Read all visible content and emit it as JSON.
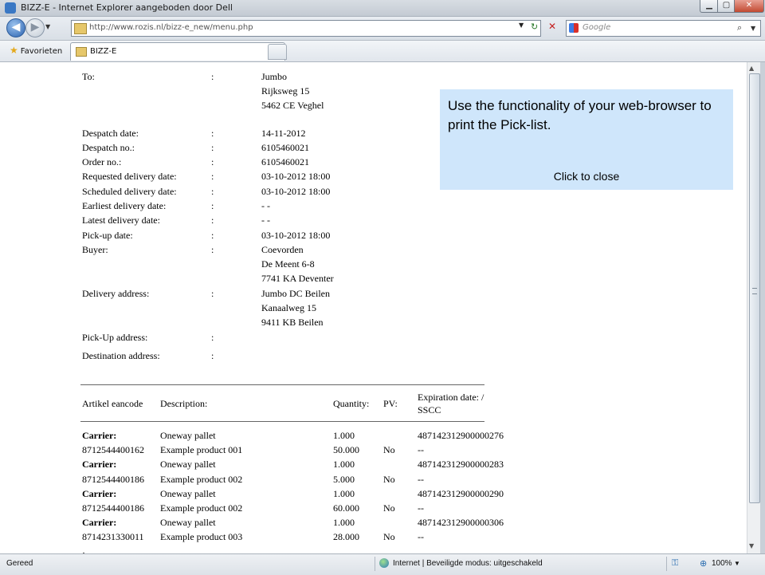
{
  "window": {
    "title": "BIZZ-E - Internet Explorer aangeboden door Dell",
    "min_glyph": "▁",
    "max_glyph": "▢",
    "close_glyph": "✕"
  },
  "toolbar": {
    "url": "http://www.rozis.nl/bizz-e_new/menu.php",
    "back_glyph": "◀",
    "forward_glyph": "▶",
    "refresh_glyph": "↻",
    "stop_glyph": "✕",
    "search_placeholder": "Google",
    "search_glyph": "⌕",
    "dropdown_glyph": "▼"
  },
  "favorites": {
    "favorites_label": "Favorieten",
    "tab_label": "BIZZ-E"
  },
  "header_fields": [
    {
      "label": "To:",
      "sep": ":",
      "lines": [
        "Jumbo",
        "Rijksweg 15",
        "5462 CE Veghel"
      ]
    },
    {
      "label": "Despatch date:",
      "sep": ":",
      "lines": [
        "14-11-2012"
      ]
    },
    {
      "label": "Despatch no.:",
      "sep": ":",
      "lines": [
        "6105460021"
      ]
    },
    {
      "label": "Order no.:",
      "sep": ":",
      "lines": [
        "6105460021"
      ]
    },
    {
      "label": "Requested delivery date:",
      "sep": ":",
      "lines": [
        "03-10-2012 18:00"
      ]
    },
    {
      "label": "Scheduled delivery date:",
      "sep": ":",
      "lines": [
        "03-10-2012 18:00"
      ]
    },
    {
      "label": "Earliest delivery date:",
      "sep": ":",
      "lines": [
        "- -"
      ]
    },
    {
      "label": "Latest delivery date:",
      "sep": ":",
      "lines": [
        "- -"
      ]
    },
    {
      "label": "Pick-up date:",
      "sep": ":",
      "lines": [
        "03-10-2012 18:00"
      ]
    },
    {
      "label": "Buyer:",
      "sep": ":",
      "lines": [
        "Coevorden",
        "De Meent 6-8",
        "7741 KA Deventer"
      ]
    },
    {
      "label": "Delivery address:",
      "sep": ":",
      "lines": [
        "Jumbo DC Beilen",
        "Kanaalweg 15",
        "9411 KB Beilen"
      ]
    },
    {
      "label": "Pick-Up address:",
      "sep": ":",
      "lines": []
    },
    {
      "label": "Destination address:",
      "sep": ":",
      "lines": []
    }
  ],
  "table": {
    "headers": [
      "Artikel eancode",
      "Description:",
      "Quantity:",
      "PV:",
      "Expiration date: /",
      "SSCC"
    ],
    "rows": [
      [
        "Carrier:",
        "Oneway pallet",
        "1.000",
        "",
        "487142312900000276"
      ],
      [
        "8712544400162",
        "Example product 001",
        "50.000",
        "No",
        "--"
      ],
      [
        "Carrier:",
        "Oneway pallet",
        "1.000",
        "",
        "487142312900000283"
      ],
      [
        "8712544400186",
        "Example product 002",
        "5.000",
        "No",
        "--"
      ],
      [
        "Carrier:",
        "Oneway pallet",
        "1.000",
        "",
        "487142312900000290"
      ],
      [
        "8712544400186",
        "Example product 002",
        "60.000",
        "No",
        "--"
      ],
      [
        "Carrier:",
        "Oneway pallet",
        "1.000",
        "",
        "487142312900000306"
      ],
      [
        "8714231330011",
        "Example product 003",
        "28.000",
        "No",
        "--"
      ]
    ]
  },
  "popup": {
    "message": "Use the functionality of your web-browser to print the Pick-list.",
    "close_label": "Click to close",
    "bg_color": "#cfe6fb"
  },
  "statusbar": {
    "left_text": "Gereed",
    "zone_text": "Internet | Beveiligde modus: uitgeschakeld",
    "zoom": "100%",
    "zoom_glyph": "⊕",
    "security_glyph": "⚿"
  }
}
